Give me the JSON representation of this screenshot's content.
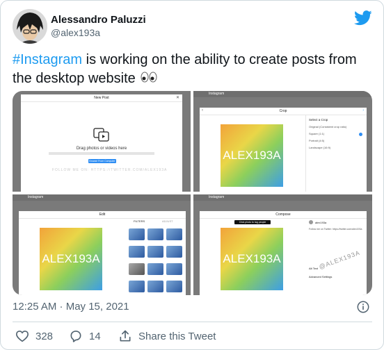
{
  "author": {
    "name": "Alessandro Paluzzi",
    "handle": "@alex193a"
  },
  "tweet": {
    "hashtag": "#Instagram",
    "body": " is working on the ability to create posts from the desktop website "
  },
  "screens": {
    "s1": {
      "title": "New Post",
      "drag_text": "Drag photos or videos here",
      "button": "Browse From Computer",
      "watermark": "FOLLOW ME ON: HTTPS://TWITTER.COM/ALEX193A"
    },
    "s2": {
      "title": "Crop",
      "crop_heading": "Select a Crop",
      "options": [
        "Original (Consistent crop ratio)",
        "Square (1:1)",
        "Portrait (4:5)",
        "Landscape (16:9)"
      ],
      "image_text": "ALEX193A"
    },
    "s3": {
      "title": "Edit",
      "filters_tab": "FILTERS",
      "adjust_tab": "ADJUST",
      "image_text": "ALEX193A"
    },
    "s4": {
      "title": "Compose",
      "tooltip": "Click photo to tag people",
      "user": "alex193a",
      "caption": "Follow me on Twitter: https://twitter.com/alex193a",
      "alt_text": "Alt Text",
      "advanced": "Advanced Settings",
      "image_text": "ALEX193A",
      "watermark": "@ALEX193A"
    },
    "app_name": "Instagram"
  },
  "meta": {
    "timestamp": "12:25 AM · May 15, 2021"
  },
  "actions": {
    "likes": "328",
    "replies": "14",
    "share": "Share this Tweet"
  },
  "colors": {
    "accent": "#1d9bf0",
    "text": "#0f1419",
    "muted": "#536471"
  }
}
